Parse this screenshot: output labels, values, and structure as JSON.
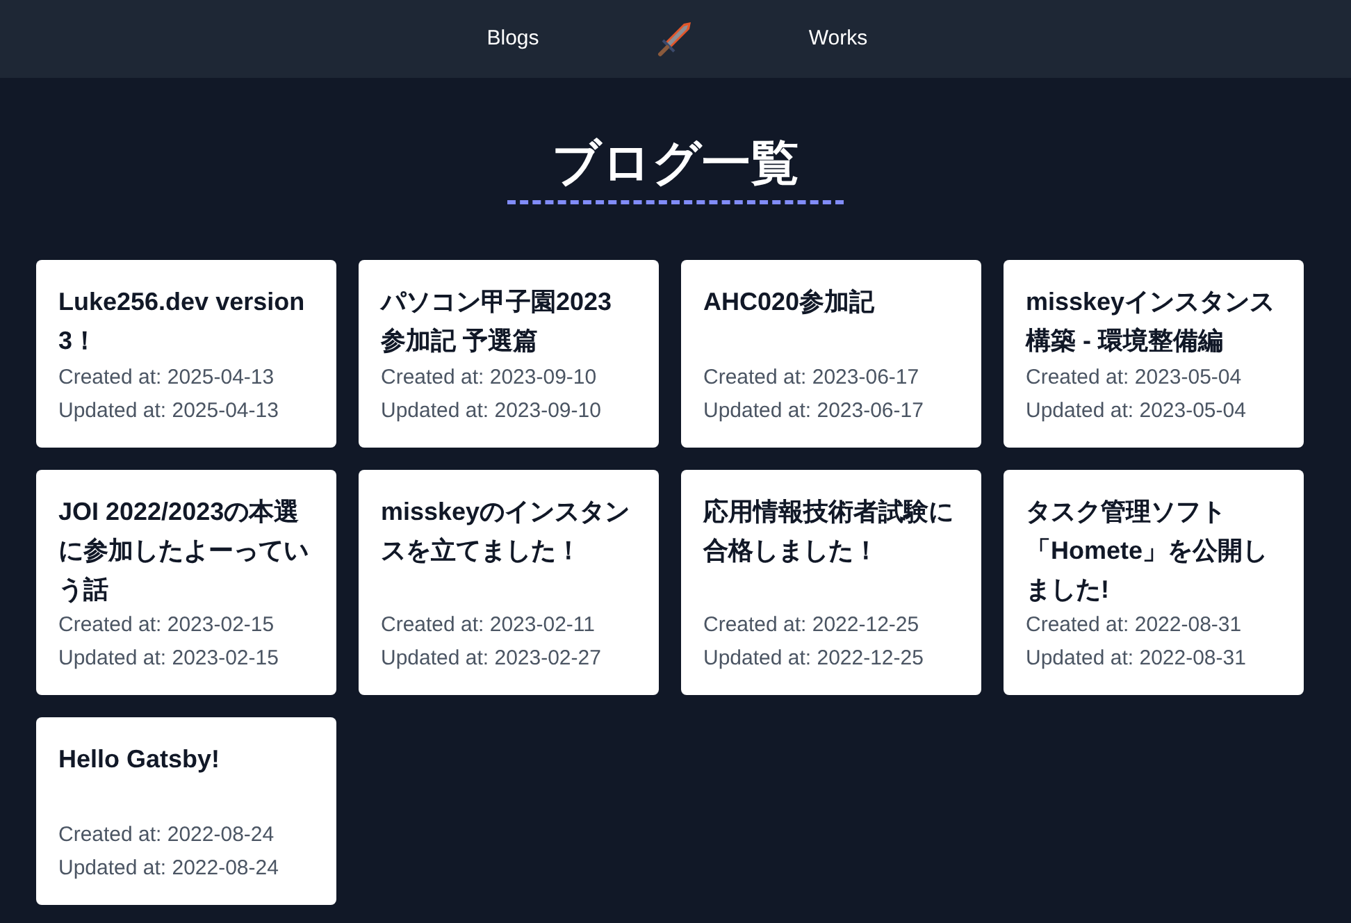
{
  "nav": {
    "left": "Blogs",
    "right": "Works"
  },
  "heading": "ブログ一覧",
  "posts": [
    {
      "title": "Luke256.dev version 3！",
      "created": "Created at: 2025-04-13",
      "updated": "Updated at: 2025-04-13"
    },
    {
      "title": "パソコン甲子園2023 参加記 予選篇",
      "created": "Created at: 2023-09-10",
      "updated": "Updated at: 2023-09-10"
    },
    {
      "title": "AHC020参加記",
      "created": "Created at: 2023-06-17",
      "updated": "Updated at: 2023-06-17"
    },
    {
      "title": "misskeyインスタンス構築 - 環境整備編",
      "created": "Created at: 2023-05-04",
      "updated": "Updated at: 2023-05-04"
    },
    {
      "title": "JOI 2022/2023の本選に参加したよーっていう話",
      "created": "Created at: 2023-02-15",
      "updated": "Updated at: 2023-02-15"
    },
    {
      "title": "misskeyのインスタンスを立てました！",
      "created": "Created at: 2023-02-11",
      "updated": "Updated at: 2023-02-27"
    },
    {
      "title": "応用情報技術者試験に合格しました！",
      "created": "Created at: 2022-12-25",
      "updated": "Updated at: 2022-12-25"
    },
    {
      "title": "タスク管理ソフト「Homete」を公開しました!",
      "created": "Created at: 2022-08-31",
      "updated": "Updated at: 2022-08-31"
    },
    {
      "title": "Hello Gatsby!",
      "created": "Created at: 2022-08-24",
      "updated": "Updated at: 2022-08-24"
    }
  ]
}
